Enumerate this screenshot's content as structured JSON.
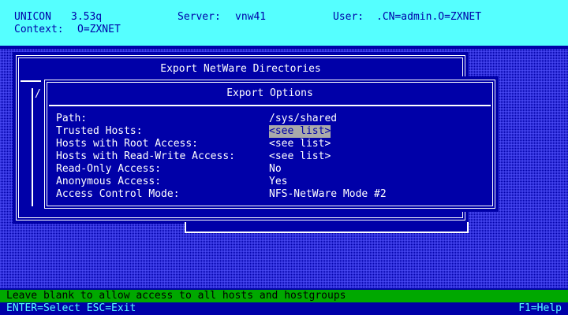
{
  "header": {
    "app": "UNICON",
    "version": "3.53q",
    "server_label": "Server:",
    "server_value": "vnw41",
    "user_label": "User:",
    "user_value": ".CN=admin.O=ZXNET",
    "context_label": "Context:",
    "context_value": "O=ZXNET"
  },
  "outer_window": {
    "title": "Export NetWare Directories",
    "left_marker": "/"
  },
  "dialog": {
    "title": "Export Options",
    "fields": [
      {
        "label": "Path:",
        "value": "/sys/shared"
      },
      {
        "label": "Trusted Hosts:",
        "value": "<see list>"
      },
      {
        "label": "Hosts with Root Access:",
        "value": "<see list>"
      },
      {
        "label": "Hosts with Read-Write Access:",
        "value": "<see list>"
      },
      {
        "label": "Read-Only Access:",
        "value": "No"
      },
      {
        "label": "Anonymous Access:",
        "value": "Yes"
      },
      {
        "label": "Access Control Mode:",
        "value": "NFS-NetWare Mode #2"
      }
    ]
  },
  "status": {
    "message": "Leave blank to allow access to all hosts and hostgroups",
    "keys_left": "ENTER=Select ESC=Exit",
    "keys_right": "F1=Help"
  },
  "colors": {
    "background": "#0000a8",
    "header": "#55ffff",
    "status_bar": "#00a800",
    "highlight": "#aaaaaa",
    "text": "#ffffff"
  }
}
